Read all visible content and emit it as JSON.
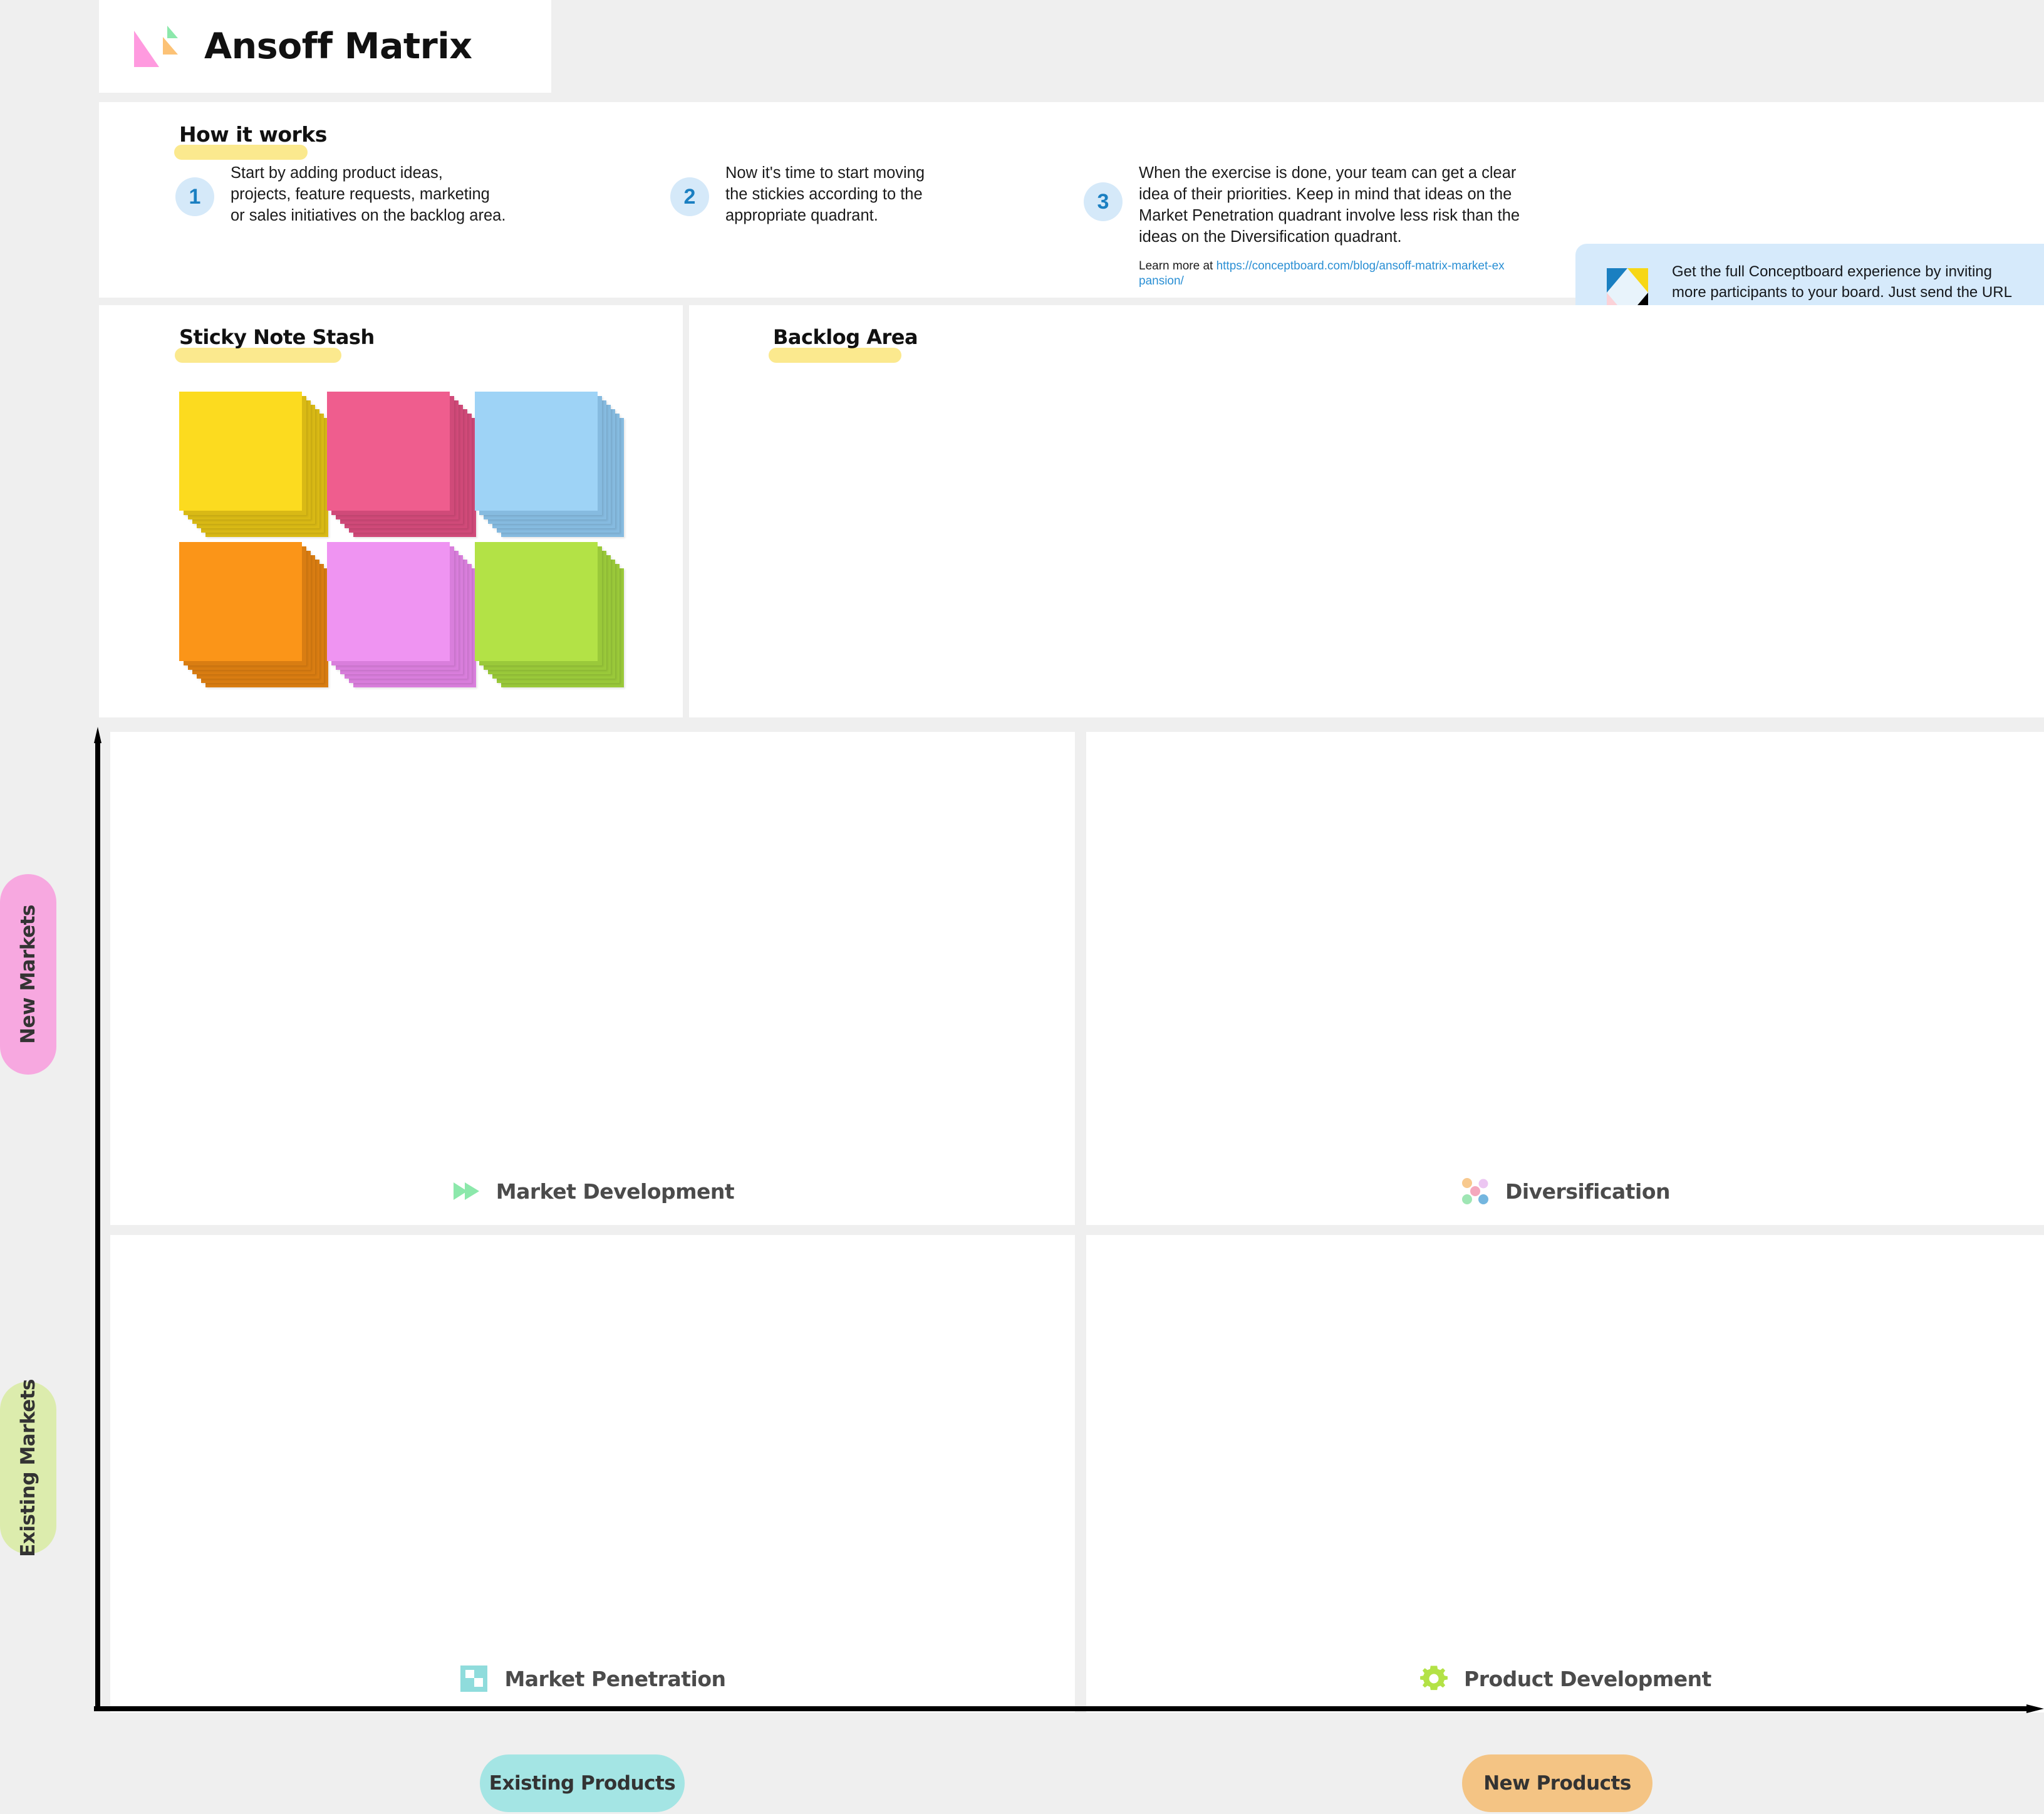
{
  "title": {
    "text": "Ansoff Matrix",
    "logo_colors": {
      "pink": "#ff9adf",
      "orange": "#fcc276",
      "green": "#8ce8ab"
    }
  },
  "how_it_works": {
    "heading": "How it works",
    "steps": [
      {
        "number": "1",
        "text": "Start by adding product ideas,\nprojects, feature requests, marketing\nor sales initiatives on the backlog area."
      },
      {
        "number": "2",
        "text": "Now it's time to start moving\nthe stickies according to the\nappropriate quadrant."
      },
      {
        "number": "3",
        "text": "When the exercise is done, your team can get a clear\nidea of their priorities. Keep in mind that ideas on the\nMarket Penetration quadrant involve less risk than the\nideas on the Diversification quadrant.",
        "learn_more_prefix": "Learn more at ",
        "learn_more_url": "https://conceptboard.com/blog/ansoff-matrix-market-expansion/"
      }
    ]
  },
  "promo": {
    "text": "Get the full Conceptboard experience by inviting\nmore participants to your board. Just send the URL\nto your teammates and start collaborating!",
    "background": "#d6eafb",
    "logo_colors": {
      "blue": "#1a7fc1",
      "yellow": "#f7d716",
      "pink": "#fbd2d8",
      "black": "#000000",
      "center": "#e8f3fb"
    }
  },
  "stash": {
    "heading": "Sticky Note Stash",
    "stacks": [
      {
        "name": "yellow-sticky-stack",
        "color": "#fcdb1f",
        "shadow": "#d9b915"
      },
      {
        "name": "pink-sticky-stack",
        "color": "#ef5d8e",
        "shadow": "#d04a79"
      },
      {
        "name": "blue-sticky-stack",
        "color": "#9ed3f6",
        "shadow": "#86bbe0"
      },
      {
        "name": "orange-sticky-stack",
        "color": "#fb9518",
        "shadow": "#d97d12"
      },
      {
        "name": "violet-sticky-stack",
        "color": "#ef94f2",
        "shadow": "#d97edc"
      },
      {
        "name": "green-sticky-stack",
        "color": "#b3e246",
        "shadow": "#9ac93a"
      }
    ]
  },
  "backlog": {
    "heading": "Backlog Area"
  },
  "matrix": {
    "quadrants": [
      {
        "id": "market-development",
        "label": "Market Development",
        "icon": "fast-forward-icon",
        "icon_color": "#8ce8ab"
      },
      {
        "id": "diversification",
        "label": "Diversification",
        "icon": "dots-cluster-icon",
        "icon_color": "#f4b16b"
      },
      {
        "id": "market-penetration",
        "label": "Market Penetration",
        "icon": "checker-square-icon",
        "icon_color": "#8fdcdc"
      },
      {
        "id": "product-development",
        "label": "Product Development",
        "icon": "gear-icon",
        "icon_color": "#b3e246"
      }
    ],
    "y_axis": {
      "top_label": "New Markets",
      "bottom_label": "Existing Markets",
      "top_color": "#f7a8e0",
      "bottom_color": "#dcecad"
    },
    "x_axis": {
      "left_label": "Existing Products",
      "right_label": "New Products",
      "left_color": "#a4e5e4",
      "right_color": "#f4c484"
    }
  }
}
